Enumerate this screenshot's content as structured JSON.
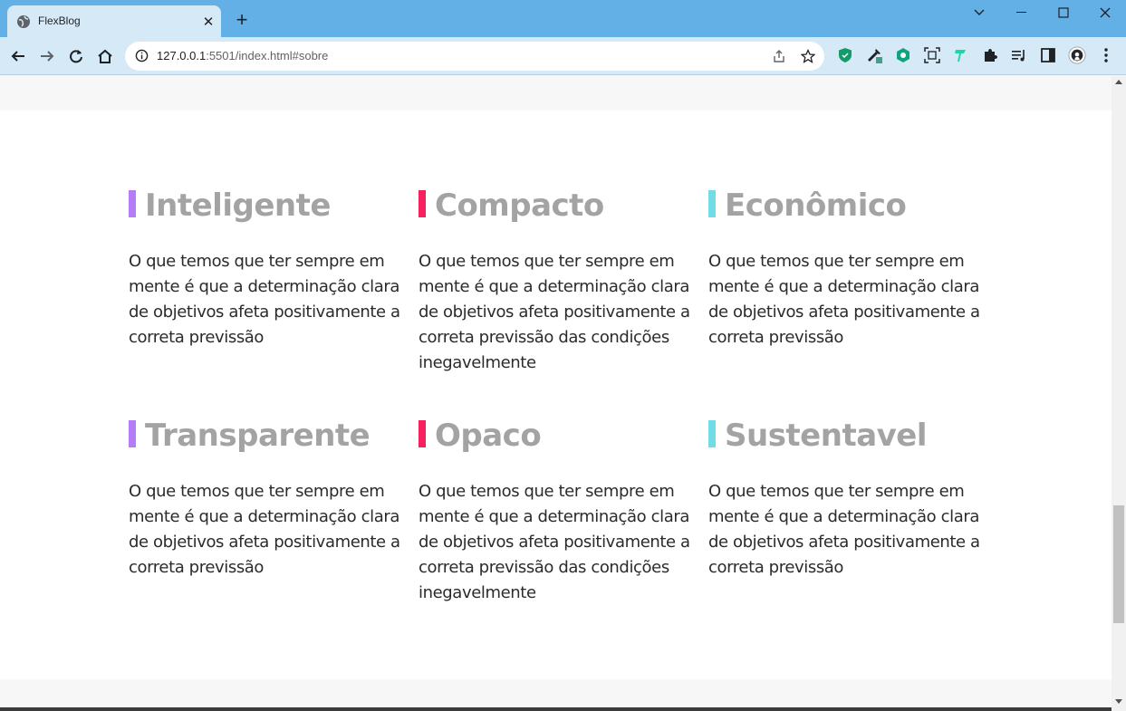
{
  "browser": {
    "tab_title": "FlexBlog",
    "url_host": "127.0.0.1",
    "url_rest": ":5501/index.html#sobre",
    "new_tab_label": "+",
    "close_label": "✕"
  },
  "colors": {
    "purple": "#b57cf6",
    "pink": "#f6215e",
    "cyan": "#6fdce8",
    "heading": "#a3a3a3",
    "text": "#2b2b2b"
  },
  "features": [
    {
      "title": "Inteligente",
      "accent": "purple",
      "text": "O que temos que ter sempre em mente é que a determinação clara de objetivos afeta positivamente a correta previssão"
    },
    {
      "title": "Compacto",
      "accent": "pink",
      "text": "O que temos que ter sempre em mente é que a determinação clara de objetivos afeta positivamente a correta previssão das condições inegavelmente"
    },
    {
      "title": "Econômico",
      "accent": "cyan",
      "text": "O que temos que ter sempre em mente é que a determinação clara de objetivos afeta positivamente a correta previssão"
    },
    {
      "title": "Transparente",
      "accent": "purple",
      "text": "O que temos que ter sempre em mente é que a determinação clara de objetivos afeta positivamente a correta previssão"
    },
    {
      "title": "Opaco",
      "accent": "pink",
      "text": "O que temos que ter sempre em mente é que a determinação clara de objetivos afeta positivamente a correta previssão das condições inegavelmente"
    },
    {
      "title": "Sustentavel",
      "accent": "cyan",
      "text": "O que temos que ter sempre em mente é que a determinação clara de objetivos afeta positivamente a correta previssão"
    }
  ]
}
